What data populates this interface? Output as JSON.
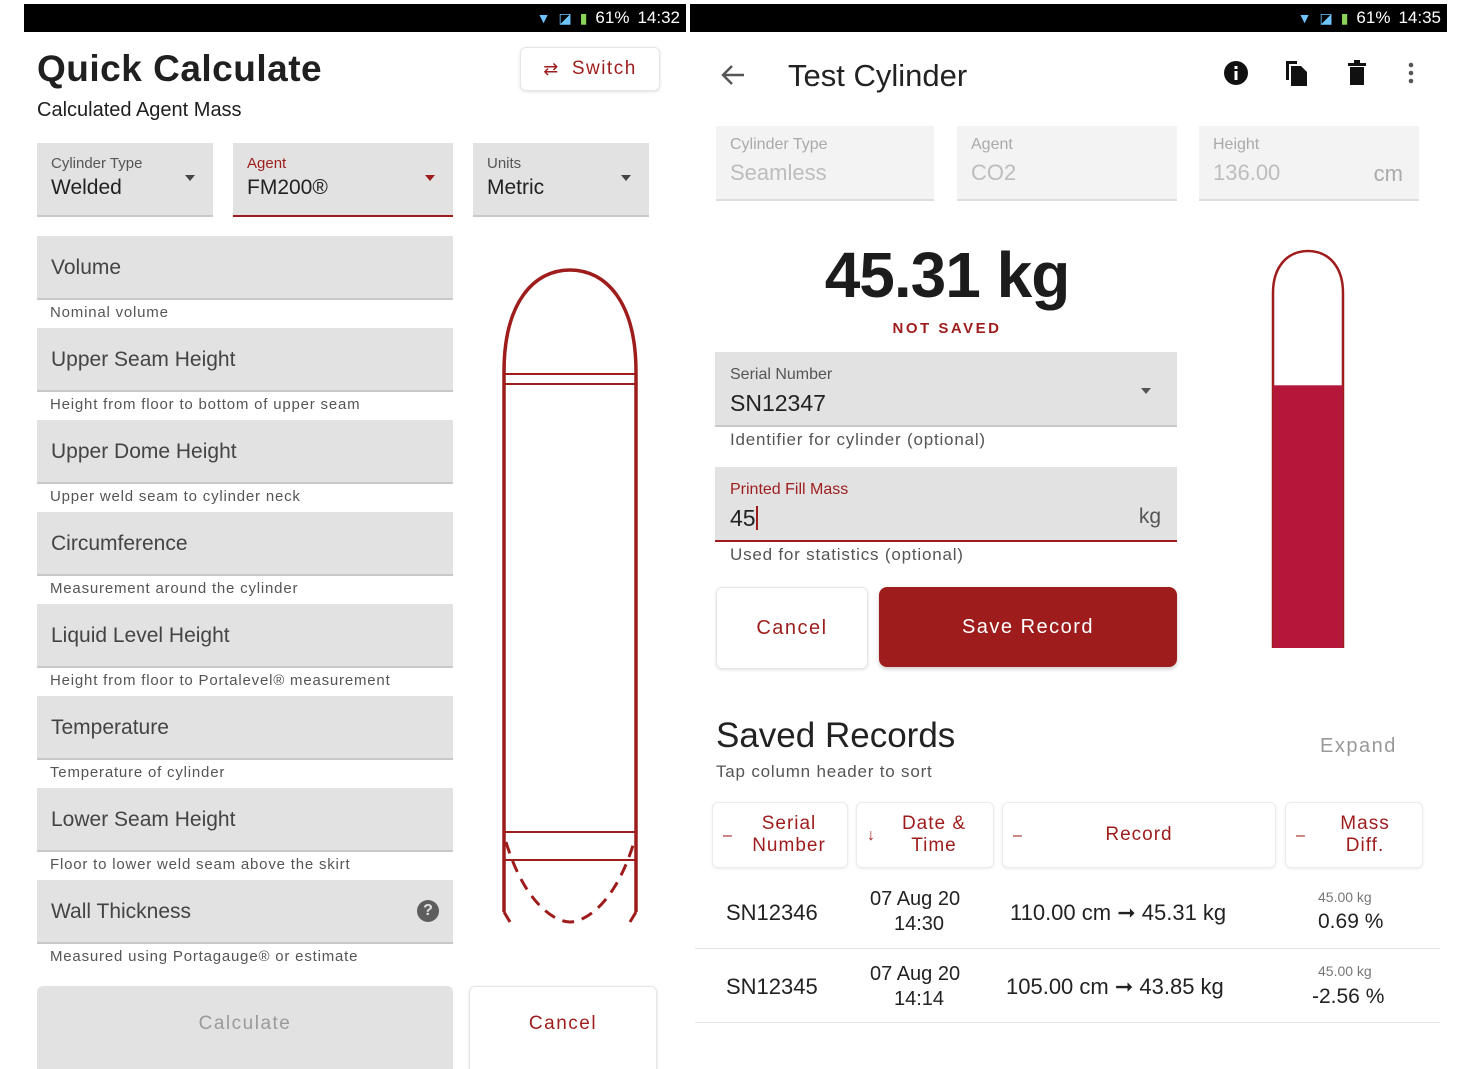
{
  "status_left": {
    "battery": "61%",
    "time": "14:32"
  },
  "status_right": {
    "battery": "61%",
    "time": "14:35"
  },
  "quick": {
    "title": "Quick Calculate",
    "subtitle": "Calculated Agent Mass",
    "switch_label": "Switch",
    "cylinder_type": {
      "label": "Cylinder Type",
      "value": "Welded"
    },
    "agent": {
      "label": "Agent",
      "value": "FM200®"
    },
    "units": {
      "label": "Units",
      "value": "Metric"
    },
    "fields": [
      {
        "label": "Volume",
        "helper": "Nominal volume"
      },
      {
        "label": "Upper Seam Height",
        "helper": "Height from floor to bottom of upper seam"
      },
      {
        "label": "Upper Dome Height",
        "helper": "Upper weld seam to cylinder neck"
      },
      {
        "label": "Circumference",
        "helper": "Measurement around the cylinder"
      },
      {
        "label": "Liquid Level Height",
        "helper": "Height from floor to Portalevel® measurement"
      },
      {
        "label": "Temperature",
        "helper": "Temperature of cylinder"
      },
      {
        "label": "Lower Seam Height",
        "helper": "Floor to lower weld seam above the skirt"
      },
      {
        "label": "Wall Thickness",
        "helper": "Measured using Portagauge® or estimate"
      }
    ],
    "help_icon": "?",
    "calculate_label": "Calculate",
    "cancel_label": "Cancel"
  },
  "detail": {
    "title": "Test Cylinder",
    "cylinder_type": {
      "label": "Cylinder Type",
      "value": "Seamless"
    },
    "agent": {
      "label": "Agent",
      "value": "CO2"
    },
    "height": {
      "label": "Height",
      "value": "136.00",
      "unit": "cm"
    },
    "mass": "45.31 kg",
    "save_state": "NOT SAVED",
    "fill_fraction": 0.74,
    "serial": {
      "label": "Serial Number",
      "value": "SN12347",
      "helper": "Identifier for cylinder (optional)"
    },
    "printed_fill": {
      "label": "Printed Fill Mass",
      "value": "45",
      "unit": "kg",
      "helper": "Used for statistics (optional)"
    },
    "cancel_label": "Cancel",
    "save_label": "Save Record",
    "records_title": "Saved Records",
    "records_hint": "Tap column header to sort",
    "expand_label": "Expand",
    "headers": {
      "serial": "Serial Number",
      "date": "Date & Time",
      "record": "Record",
      "mass": "Mass Diff."
    },
    "rows": [
      {
        "serial": "SN12346",
        "date": "07 Aug 20",
        "time": "14:30",
        "record": "110.00 cm ➞ 45.31 kg",
        "mass_small": "45.00 kg",
        "diff": "0.69 %"
      },
      {
        "serial": "SN12345",
        "date": "07 Aug 20",
        "time": "14:14",
        "record": "105.00 cm ➞ 43.85 kg",
        "mass_small": "45.00 kg",
        "diff": "-2.56 %"
      }
    ]
  },
  "colors": {
    "accent": "#9e1c1c",
    "liquid": "#b5173a"
  }
}
